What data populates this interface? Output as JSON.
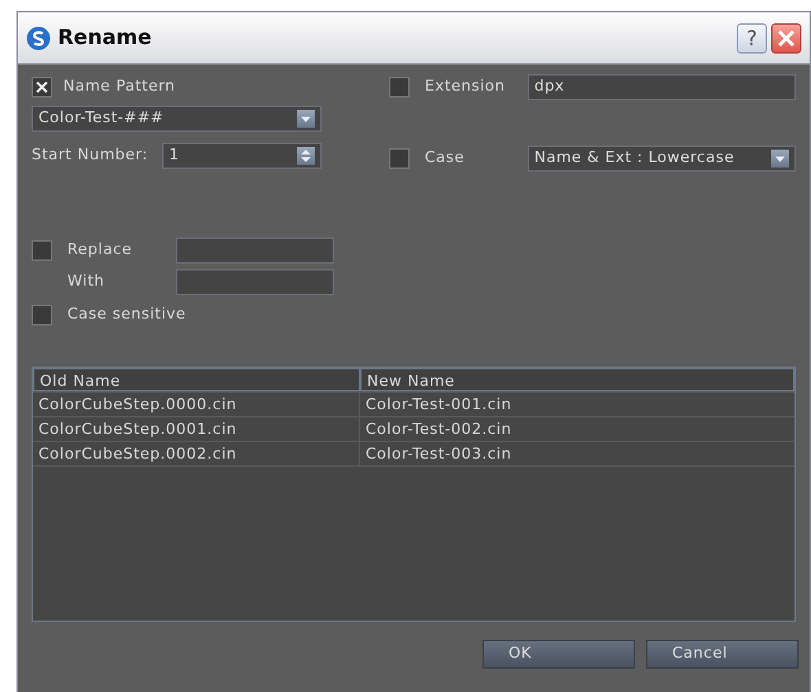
{
  "window": {
    "title": "Rename",
    "help_button": "?"
  },
  "name_pattern": {
    "label": "Name Pattern",
    "checked": true,
    "value": "Color-Test-###"
  },
  "start_number": {
    "label": "Start Number:",
    "value": "1"
  },
  "extension": {
    "label": "Extension",
    "checked": false,
    "value": "dpx"
  },
  "case": {
    "label": "Case",
    "checked": false,
    "value": "Name & Ext : Lowercase"
  },
  "replace": {
    "label": "Replace",
    "checked": false,
    "with_label": "With"
  },
  "case_sensitive": {
    "label": "Case sensitive",
    "checked": false
  },
  "table": {
    "columns": [
      "Old Name",
      "New Name"
    ],
    "rows": [
      [
        "ColorCubeStep.0000.cin",
        "Color-Test-001.cin"
      ],
      [
        "ColorCubeStep.0001.cin",
        "Color-Test-002.cin"
      ],
      [
        "ColorCubeStep.0002.cin",
        "Color-Test-003.cin"
      ]
    ]
  },
  "buttons": [
    "OK",
    "Cancel"
  ]
}
